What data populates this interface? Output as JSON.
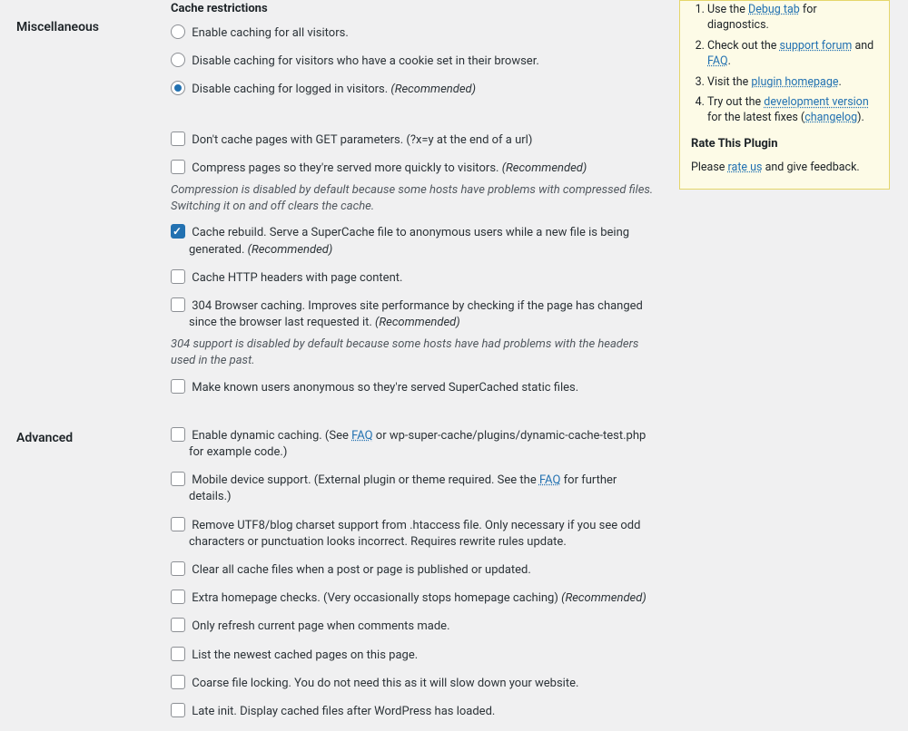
{
  "sections": {
    "misc": {
      "label": "Miscellaneous",
      "legend": "Cache restrictions",
      "radio1": "Enable caching for all visitors.",
      "radio2": "Disable caching for visitors who have a cookie set in their browser.",
      "radio3": "Disable caching for logged in visitors.",
      "radio3_rec": "(Recommended)",
      "get_params": "Don't cache pages with GET parameters. (?x=y at the end of a url)",
      "compress": "Compress pages so they're served more quickly to visitors.",
      "compress_rec": "(Recommended)",
      "compress_note": "Compression is disabled by default because some hosts have problems with compressed files. Switching it on and off clears the cache.",
      "rebuild": "Cache rebuild. Serve a SuperCache file to anonymous users while a new file is being generated.",
      "rebuild_rec": "(Recommended)",
      "http_headers": "Cache HTTP headers with page content.",
      "browser_cache": "304 Browser caching. Improves site performance by checking if the page has changed since the browser last requested it.",
      "browser_cache_rec": "(Recommended)",
      "browser_cache_note": "304 support is disabled by default because some hosts have had problems with the headers used in the past.",
      "anon": "Make known users anonymous so they're served SuperCached static files."
    },
    "adv": {
      "label": "Advanced",
      "dynamic_pre": "Enable dynamic caching. (See ",
      "dynamic_link": "FAQ",
      "dynamic_post": " or wp-super-cache/plugins/dynamic-cache-test.php for example code.)",
      "mobile_pre": "Mobile device support. (External plugin or theme required. See the ",
      "mobile_link": "FAQ",
      "mobile_post": " for further details.)",
      "utf8": "Remove UTF8/blog charset support from .htaccess file. Only necessary if you see odd characters or punctuation looks incorrect. Requires rewrite rules update.",
      "clear_publish": "Clear all cache files when a post or page is published or updated.",
      "extra_home": "Extra homepage checks. (Very occasionally stops homepage caching)",
      "extra_home_rec": "(Recommended)",
      "refresh_comment": "Only refresh current page when comments made.",
      "list_newest": "List the newest cached pages on this page.",
      "coarse_lock": "Coarse file locking. You do not need this as it will slow down your website.",
      "late_init": "Late init. Display cached files after WordPress has loaded."
    }
  },
  "sidebar": {
    "li1_pre": "Use the ",
    "li1_link": "Debug tab",
    "li1_post": " for diagnostics.",
    "li2_pre": "Check out the ",
    "li2_link1": "support forum",
    "li2_mid": " and ",
    "li2_link2": "FAQ",
    "li2_post": ".",
    "li3_pre": "Visit the ",
    "li3_link": "plugin homepage",
    "li3_post": ".",
    "li4_pre": "Try out the ",
    "li4_link1": "development version",
    "li4_mid": " for the latest fixes (",
    "li4_link2": "changelog",
    "li4_post": ").",
    "rate_heading": "Rate This Plugin",
    "rate_pre": "Please ",
    "rate_link": "rate us",
    "rate_post": " and give feedback."
  }
}
